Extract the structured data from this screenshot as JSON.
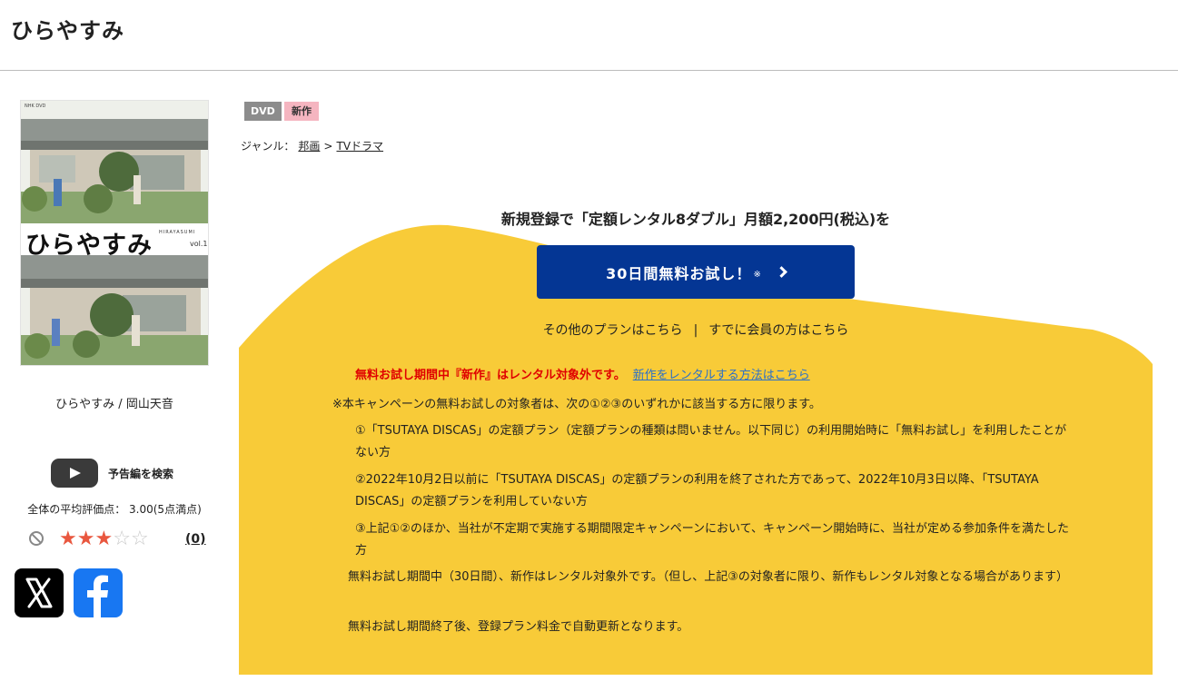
{
  "page": {
    "title": "ひらやすみ"
  },
  "product": {
    "cover_title": "ひらやすみ",
    "cover_roman": "HIRAYASUMI",
    "cover_volume": "vol.1",
    "cover_label": "NHK DVD",
    "title_author": "ひらやすみ / 岡山天音"
  },
  "trailer": {
    "label": "予告編を検索"
  },
  "rating": {
    "text": "全体の平均評価点： 3.00(5点満点)",
    "value": 3,
    "max": 5,
    "count_label": "(0)"
  },
  "share": {
    "x_icon": "x-logo-icon",
    "facebook_icon": "facebook-logo-icon"
  },
  "tags": {
    "format": "DVD",
    "status": "新作"
  },
  "genre": {
    "label": "ジャンル：",
    "items": [
      "邦画",
      "TVドラマ"
    ],
    "separator": ">"
  },
  "promo": {
    "heading": "新規登録で「定額レンタル8ダブル」月額2,200円(税込)を",
    "trial_button": "30日間無料お試し！",
    "trial_note": "※",
    "other_plans": "その他のプランはこちら",
    "divider": "|",
    "members": "すでに会員の方はこちら",
    "warning": "無料お試し期間中『新作』はレンタル対象外です。",
    "warning_link": "新作をレンタルする方法はこちら",
    "campaign_note": "※本キャンペーンの無料お試しの対象者は、次の①②③のいずれかに該当する方に限ります。",
    "conditions": [
      "①「TSUTAYA DISCAS」の定額プラン（定額プランの種類は問いません。以下同じ）の利用開始時に「無料お試し」を利用したことがない方",
      "②2022年10月2日以前に「TSUTAYA DISCAS」の定額プランの利用を終了された方であって、2022年10月3日以降、「TSUTAYA DISCAS」の定額プランを利用していない方",
      "③上記①②のほか、当社が不定期で実施する期間限定キャンペーンにおいて、キャンペーン開始時に、当社が定める参加条件を満たした方"
    ],
    "para1": "無料お試し期間中（30日間）、新作はレンタル対象外です。（但し、上記③の対象者に限り、新作もレンタル対象となる場合があります）",
    "para2": "無料お試し期間終了後、登録プラン料金で自動更新となります。"
  },
  "colors": {
    "promo_yellow": "#f8cb38",
    "trial_button": "#043694",
    "warning_red": "#e00000",
    "link_blue": "#2a6fc9",
    "star_on": "#e9573f",
    "star_off": "#c9c9c9",
    "tag_dvd": "#8c8c8c",
    "tag_new": "#f5b5c0"
  }
}
